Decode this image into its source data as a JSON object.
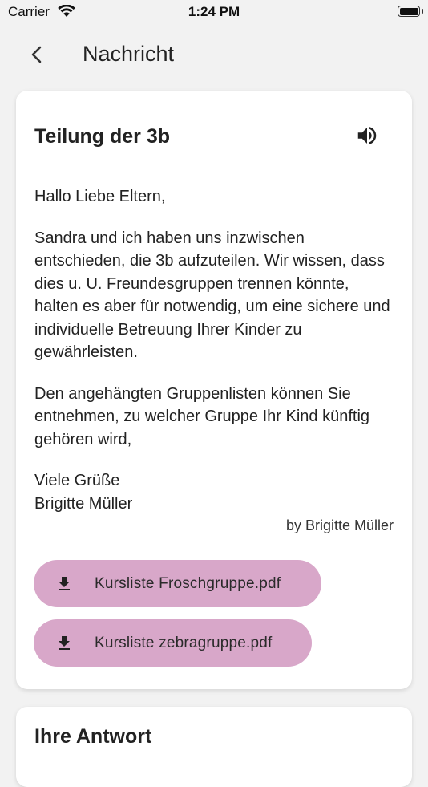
{
  "status_bar": {
    "carrier": "Carrier",
    "time": "1:24 PM"
  },
  "app_bar": {
    "title": "Nachricht",
    "back_icon": "chevron-left-icon"
  },
  "message": {
    "title": "Teilung der 3b",
    "speaker_icon": "volume-up-icon",
    "greeting": "Hallo Liebe Eltern,",
    "paragraph_1": "Sandra und ich haben uns inzwischen entschieden, die 3b aufzuteilen. Wir wissen, dass dies u. U. Freundesgruppen trennen könnte, halten es aber für notwendig, um eine sichere und individuelle Betreuung Ihrer Kinder zu gewährleisten.",
    "paragraph_2": "Den angehängten Gruppenlisten können Sie entnehmen, zu welcher Gruppe Ihr Kind künftig gehören wird,",
    "closing": "Viele Grüße",
    "signature": "Brigitte Müller",
    "author_line": "by Brigitte Müller",
    "attachments": [
      {
        "label": "Kursliste Froschgruppe.pdf",
        "icon": "download-icon"
      },
      {
        "label": "Kursliste zebragruppe.pdf",
        "icon": "download-icon"
      }
    ]
  },
  "reply": {
    "title": "Ihre Antwort"
  },
  "colors": {
    "background": "#f2f2f2",
    "card": "#ffffff",
    "attachment_button": "#d8a7c9"
  }
}
